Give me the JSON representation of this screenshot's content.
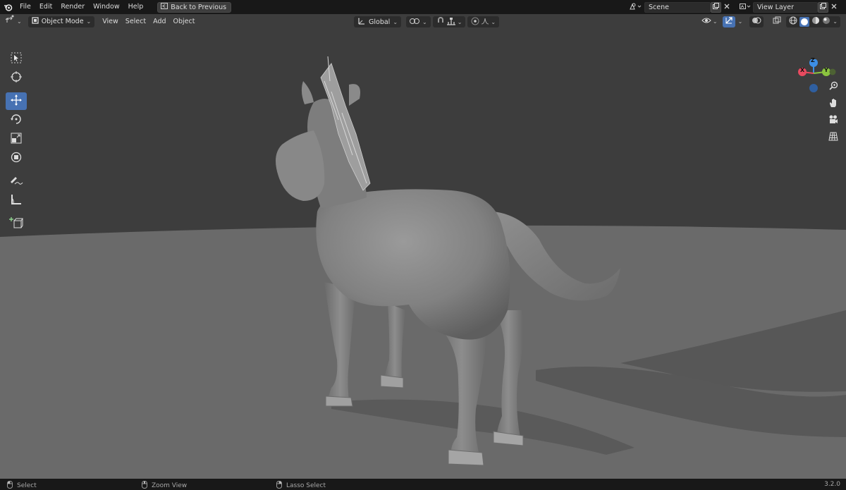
{
  "menubar": {
    "items": [
      "File",
      "Edit",
      "Render",
      "Window",
      "Help"
    ],
    "back_button": "Back to Previous",
    "scene": "Scene",
    "view_layer": "View Layer"
  },
  "header": {
    "mode": "Object Mode",
    "menus": [
      "View",
      "Select",
      "Add",
      "Object"
    ],
    "orientation": "Global"
  },
  "toolbar": {
    "tools": [
      "select-box",
      "cursor",
      "move",
      "rotate",
      "scale",
      "transform",
      "annotate",
      "measure",
      "add-cube"
    ],
    "active": "move"
  },
  "gizmo": {
    "x": "X",
    "y": "Y",
    "z": "Z"
  },
  "statusbar": {
    "select": "Select",
    "zoom": "Zoom View",
    "lasso": "Lasso Select",
    "version": "3.2.0"
  },
  "colors": {
    "accent": "#4772b3",
    "x_axis": "#e84a5f",
    "y_axis": "#8bc43f",
    "z_axis": "#3d8fe6"
  }
}
